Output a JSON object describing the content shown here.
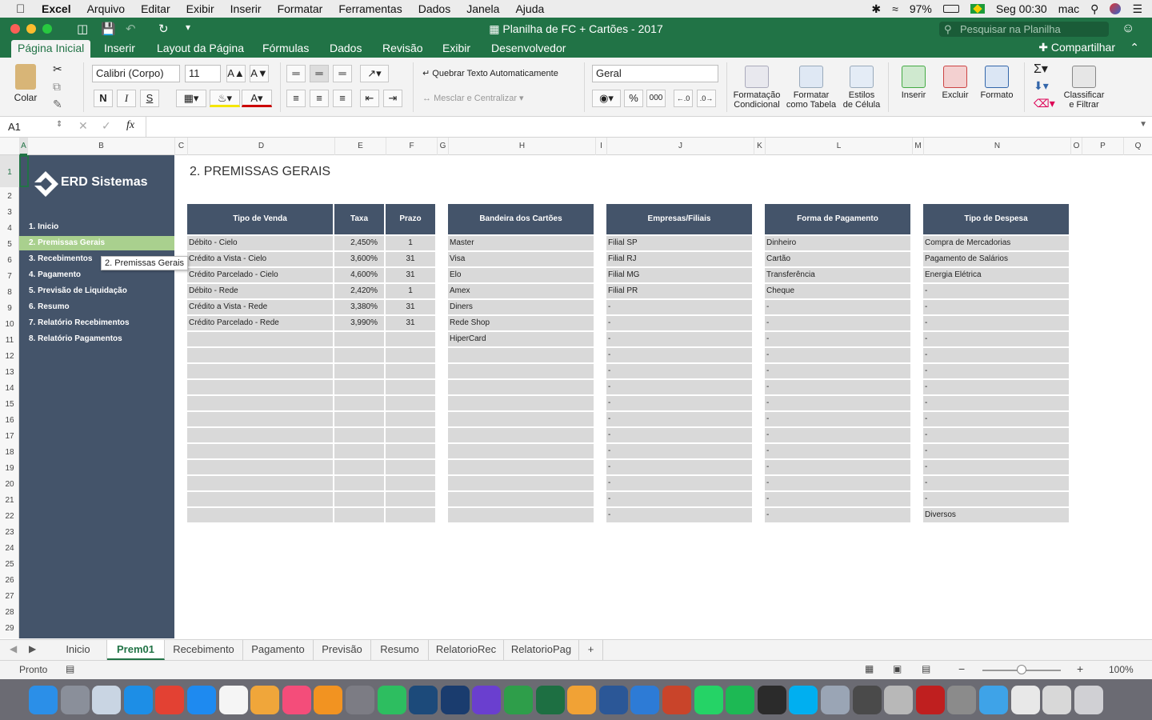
{
  "menubar": {
    "apple": "",
    "items": [
      "Excel",
      "Arquivo",
      "Editar",
      "Exibir",
      "Inserir",
      "Formatar",
      "Ferramentas",
      "Dados",
      "Janela",
      "Ajuda"
    ],
    "battery": "97%",
    "clock": "Seg 00:30",
    "user": "mac"
  },
  "window": {
    "title": "Planilha de FC + Cartões - 2017",
    "search_placeholder": "Pesquisar na Planilha"
  },
  "ribbon_tabs": [
    "Página Inicial",
    "Inserir",
    "Layout da Página",
    "Fórmulas",
    "Dados",
    "Revisão",
    "Exibir",
    "Desenvolvedor"
  ],
  "share_label": "Compartilhar",
  "ribbon": {
    "paste": "Colar",
    "font_name": "Calibri (Corpo)",
    "font_size": "11",
    "bold": "N",
    "italic": "I",
    "underline": "S",
    "wrap_text": "Quebrar Texto Automaticamente",
    "merge_center": "Mesclar e Centralizar",
    "number_format": "Geral",
    "percent": "%",
    "thousands": "000",
    "cond_format_1": "Formatação",
    "cond_format_2": "Condicional",
    "format_table_1": "Formatar",
    "format_table_2": "como Tabela",
    "cell_styles_1": "Estilos",
    "cell_styles_2": "de Célula",
    "insert": "Inserir",
    "delete": "Excluir",
    "format": "Formato",
    "sort_1": "Classificar",
    "sort_2": "e Filtrar"
  },
  "formula_bar": {
    "name_box": "A1",
    "fx": "fx",
    "content": ""
  },
  "columns": [
    "A",
    "B",
    "C",
    "D",
    "E",
    "F",
    "G",
    "H",
    "I",
    "J",
    "K",
    "L",
    "M",
    "N",
    "O",
    "P",
    "Q"
  ],
  "rows": [
    "1",
    "2",
    "3",
    "4",
    "5",
    "6",
    "7",
    "8",
    "9",
    "10",
    "11",
    "12",
    "13",
    "14",
    "15",
    "16",
    "17",
    "18",
    "19",
    "20",
    "21",
    "22",
    "23",
    "24",
    "25",
    "26",
    "27",
    "28",
    "29"
  ],
  "sidebar": {
    "logo": "ERD Sistemas",
    "items": [
      "1. Inicio",
      "2. Premissas Gerais",
      "3. Recebimentos",
      "4. Pagamento",
      "5. Previsão de Liquidação",
      "6. Resumo",
      "7. Relatório Recebimentos",
      "8. Relatório Pagamentos"
    ],
    "tooltip": "2. Premissas Gerais"
  },
  "page_title": "2. PREMISSAS GERAIS",
  "tables": {
    "headers": [
      "Tipo de Venda",
      "Taxa",
      "Prazo",
      "Bandeira dos Cartões",
      "Empresas/Filiais",
      "Forma de Pagamento",
      "Tipo de Despesa"
    ],
    "tipo_venda": [
      "Débito - Cielo",
      "Crédito a Vista - Cielo",
      "Crédito Parcelado - Cielo",
      "Débito - Rede",
      "Crédito a Vista - Rede",
      "Crédito Parcelado - Rede"
    ],
    "taxa": [
      "2,450%",
      "3,600%",
      "4,600%",
      "2,420%",
      "3,380%",
      "3,990%"
    ],
    "prazo": [
      "1",
      "31",
      "31",
      "1",
      "31",
      "31"
    ],
    "bandeiras": [
      "Master",
      "Visa",
      "Elo",
      "Amex",
      "Diners",
      "Rede Shop",
      "HiperCard"
    ],
    "empresas": [
      "Filial SP",
      "Filial RJ",
      "Filial MG",
      "Filial PR"
    ],
    "formas": [
      "Dinheiro",
      "Cartão",
      "Transferência",
      "Cheque"
    ],
    "despesas": [
      "Compra de Mercadorias",
      "Pagamento de Salários",
      "Energia Elétrica"
    ],
    "despesa_last": "Diversos",
    "dash": "-"
  },
  "sheet_tabs": [
    "Inicio",
    "Prem01",
    "Recebimento",
    "Pagamento",
    "Previsão",
    "Resumo",
    "RelatorioRec",
    "RelatorioPag",
    "+"
  ],
  "active_sheet": "Prem01",
  "status": {
    "ready": "Pronto",
    "zoom": "100%"
  },
  "colors": {
    "excel_green": "#217346",
    "nav_bg": "#44546a",
    "active_nav": "#a9d08e",
    "cell_grey": "#d9d9d9"
  }
}
